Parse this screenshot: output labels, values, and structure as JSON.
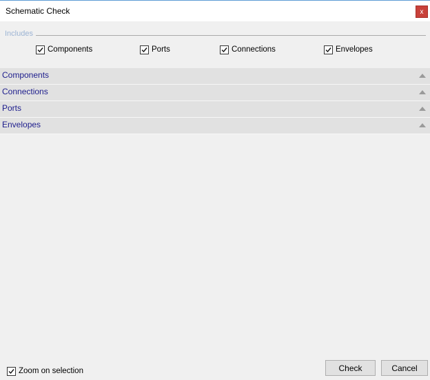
{
  "window": {
    "title": "Schematic Check",
    "close_label": "x"
  },
  "includes": {
    "group_label": "Includes",
    "options": [
      {
        "label": "Components",
        "checked": true
      },
      {
        "label": "Ports",
        "checked": true
      },
      {
        "label": "Connections",
        "checked": true
      },
      {
        "label": "Envelopes",
        "checked": true
      }
    ]
  },
  "sections": [
    {
      "label": "Components",
      "icon": "chevron-up-icon"
    },
    {
      "label": "Connections",
      "icon": "chevron-up-icon"
    },
    {
      "label": "Ports",
      "icon": "chevron-up-icon"
    },
    {
      "label": "Envelopes",
      "icon": "chevron-up-icon"
    }
  ],
  "footer": {
    "zoom_label": "Zoom on selection",
    "zoom_checked": true,
    "check_label": "Check",
    "cancel_label": "Cancel"
  },
  "colors": {
    "close_button": "#c8413a",
    "section_text": "#1c1c8c",
    "group_label": "#9cb4d4"
  }
}
